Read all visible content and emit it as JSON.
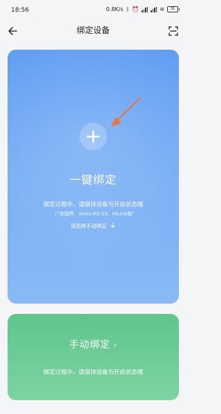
{
  "status_bar": {
    "time": "18:56",
    "net_speed": "0.8K/s",
    "battery": "31"
  },
  "nav": {
    "title": "绑定设备"
  },
  "quick_bind": {
    "title": "一键绑定",
    "hint": "绑定过程中，请保持设备为开启状态哦",
    "supported": "（“体脂秤、alves-RS-53、HiLink版”",
    "manual_link": "请选择手动绑定"
  },
  "manual_bind": {
    "title": "手动绑定",
    "hint": "绑定过程中，请保持设备为开启状态哦"
  },
  "colors": {
    "quick_card": "#6aa5f3",
    "manual_card": "#6dcc95",
    "arrow": "#e8754a"
  },
  "icons": [
    "back-arrow-icon",
    "scan-icon",
    "plus-icon",
    "down-arrow-icon",
    "chevron-right-icon"
  ]
}
